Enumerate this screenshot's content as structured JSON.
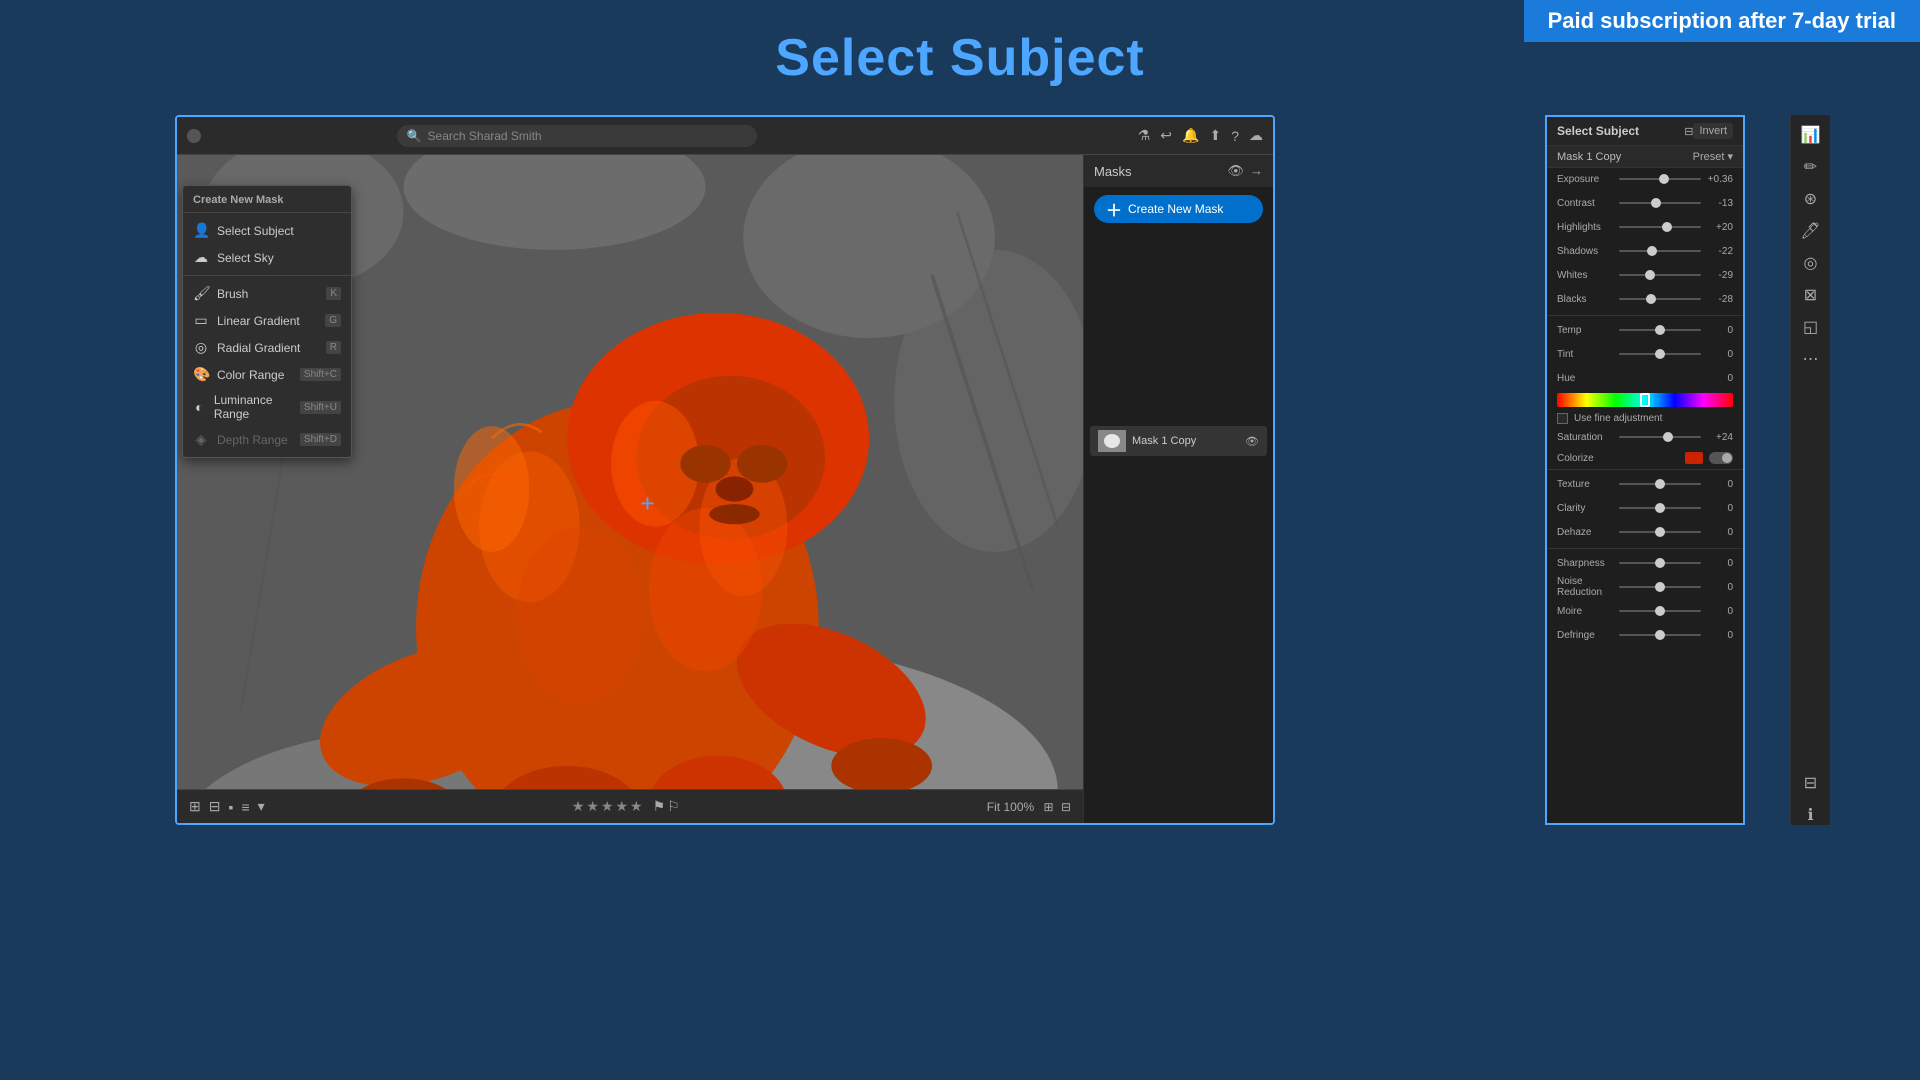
{
  "banner": {
    "text": "Paid subscription after 7-day trial"
  },
  "page_title": "Select Subject",
  "titlebar": {
    "search_placeholder": "Search Sharad Smith",
    "btn_label": "Search"
  },
  "masks_panel": {
    "title": "Masks",
    "create_new_label": "Create New Mask",
    "dropdown": {
      "section_title": "Create New Mask",
      "items": [
        {
          "icon": "👤",
          "label": "Select Subject",
          "shortcut": ""
        },
        {
          "icon": "☁",
          "label": "Select Sky",
          "shortcut": ""
        },
        {
          "icon": "🖌",
          "label": "Brush",
          "shortcut": "K"
        },
        {
          "icon": "▭",
          "label": "Linear Gradient",
          "shortcut": "G"
        },
        {
          "icon": "◎",
          "label": "Radial Gradient",
          "shortcut": "R"
        },
        {
          "icon": "🎨",
          "label": "Color Range",
          "shortcut": "Shift+C"
        },
        {
          "icon": "◐",
          "label": "Luminance Range",
          "shortcut": "Shift+U"
        },
        {
          "icon": "◈",
          "label": "Depth Range",
          "shortcut": "Shift+D"
        }
      ]
    }
  },
  "properties_panel": {
    "title": "Select Subject",
    "invert_label": "Invert",
    "mask_name": "Mask 1 Copy",
    "preset_label": "Preset",
    "sliders": [
      {
        "label": "Exposure",
        "value": "+0.36",
        "position": 55
      },
      {
        "label": "Contrast",
        "value": "-13",
        "position": 45
      },
      {
        "label": "Highlights",
        "value": "+20",
        "position": 58
      },
      {
        "label": "Shadows",
        "value": "-22",
        "position": 40
      },
      {
        "label": "Whites",
        "value": "-29",
        "position": 38
      },
      {
        "label": "Blacks",
        "value": "-28",
        "position": 39
      },
      {
        "label": "Temp",
        "value": "0",
        "position": 50
      },
      {
        "label": "Tint",
        "value": "0",
        "position": 50
      },
      {
        "label": "Hue",
        "value": "0",
        "position": 50
      },
      {
        "label": "Saturation",
        "value": "+24",
        "position": 60
      },
      {
        "label": "Colorize",
        "value": "",
        "position": 50
      },
      {
        "label": "Texture",
        "value": "0",
        "position": 50
      },
      {
        "label": "Clarity",
        "value": "0",
        "position": 50
      },
      {
        "label": "Dehaze",
        "value": "0",
        "position": 50
      },
      {
        "label": "Sharpness",
        "value": "0",
        "position": 50
      },
      {
        "label": "Noise Reduction",
        "value": "0",
        "position": 50
      },
      {
        "label": "Moire",
        "value": "0",
        "position": 50
      },
      {
        "label": "Defringe",
        "value": "0",
        "position": 50
      }
    ],
    "use_fine_adjustment": "Use fine adjustment"
  },
  "bottom_toolbar": {
    "zoom": "Fit",
    "zoom_percent": "100%",
    "stars": [
      "★",
      "★",
      "★",
      "★",
      "★"
    ]
  }
}
